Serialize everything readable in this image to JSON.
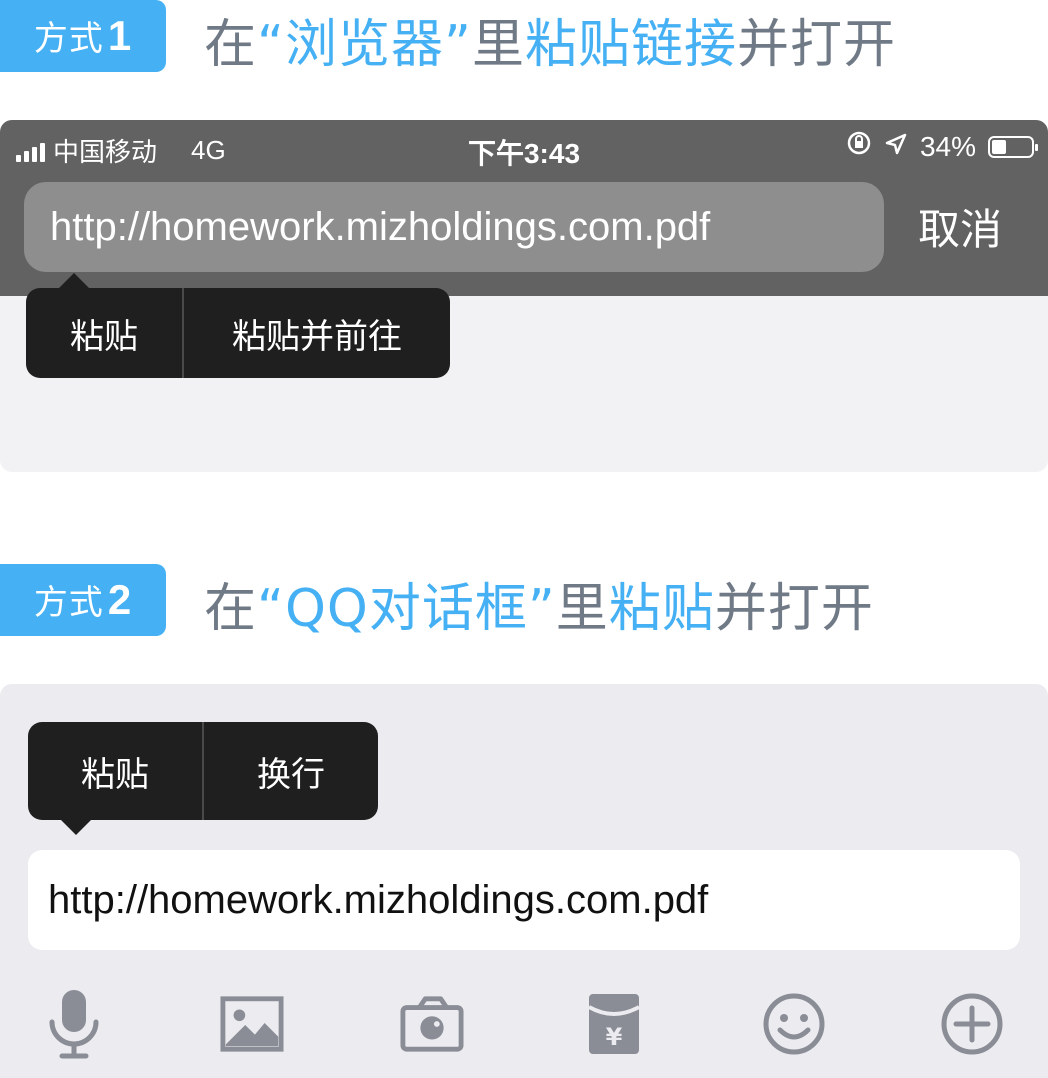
{
  "method1": {
    "badge_label": "方式",
    "badge_num": "1",
    "heading": {
      "pre": "在",
      "quote_open": "“",
      "app": "浏览器",
      "quote_close": "”",
      "mid": "里",
      "action": "粘贴链接",
      "post": "并打开"
    },
    "status_bar": {
      "carrier": "中国移动",
      "network": "4G",
      "time": "下午3:43",
      "battery": "34%"
    },
    "url_value": "http://homework.mizholdings.com.pdf",
    "cancel_label": "取消",
    "menu": [
      "粘贴",
      "粘贴并前往"
    ]
  },
  "method2": {
    "badge_label": "方式",
    "badge_num": "2",
    "heading": {
      "pre": "在",
      "quote_open": "“",
      "app": "QQ对话框",
      "quote_close": "”",
      "mid": "里",
      "action": "粘贴",
      "post": "并打开"
    },
    "menu": [
      "粘贴",
      "换行"
    ],
    "input_value": "http://homework.mizholdings.com.pdf",
    "toolbar_icons": [
      "microphone-icon",
      "image-icon",
      "camera-icon",
      "red-packet-icon",
      "emoji-icon",
      "plus-icon"
    ]
  },
  "colors": {
    "accent": "#45b0f3",
    "heading_gray": "#707a86",
    "ios_bar": "#626262",
    "menu_bg": "#1f1f20",
    "icon_gray": "#8a8d96"
  }
}
